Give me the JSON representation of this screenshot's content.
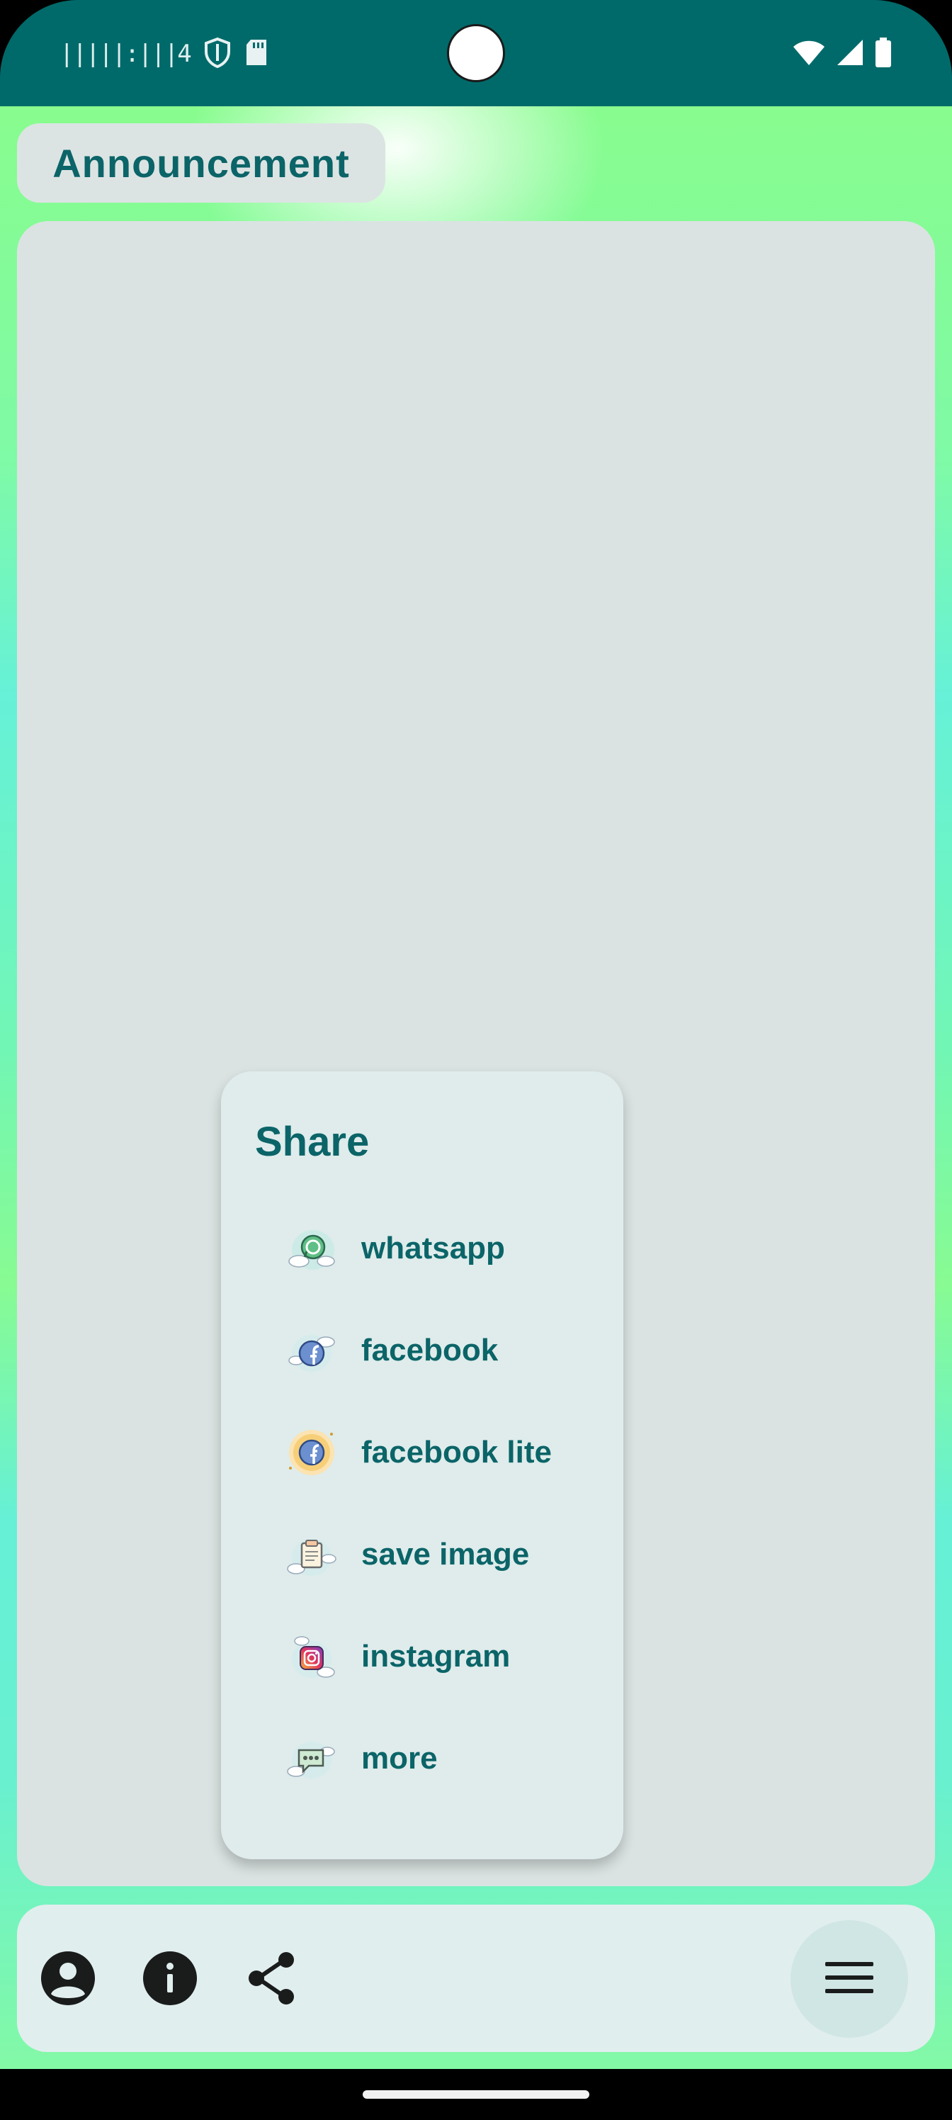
{
  "status_bar": {
    "left_text": "|||||:|||4",
    "icons": [
      "shield-icon",
      "sd-card-icon"
    ],
    "right_icons": [
      "wifi-icon",
      "cell-signal-icon",
      "battery-icon"
    ]
  },
  "header": {
    "chip_label": "Announcement"
  },
  "share_menu": {
    "title": "Share",
    "items": [
      {
        "label": "whatsapp",
        "icon": "whatsapp-icon"
      },
      {
        "label": "facebook",
        "icon": "facebook-icon"
      },
      {
        "label": "facebook lite",
        "icon": "facebook-lite-icon"
      },
      {
        "label": "save image",
        "icon": "save-image-icon"
      },
      {
        "label": "instagram",
        "icon": "instagram-icon"
      },
      {
        "label": "more",
        "icon": "more-icon"
      }
    ]
  },
  "bottom_bar": {
    "icons": [
      "account-icon",
      "info-icon",
      "share-icon"
    ],
    "fab_icon": "menu-icon"
  },
  "colors": {
    "accent": "#0b6468",
    "status_bar": "#006A6A",
    "surface": "#dae3e2",
    "card": "#dfeceb",
    "background_green": "#88fc8e",
    "background_cyan": "#66f1d8"
  }
}
